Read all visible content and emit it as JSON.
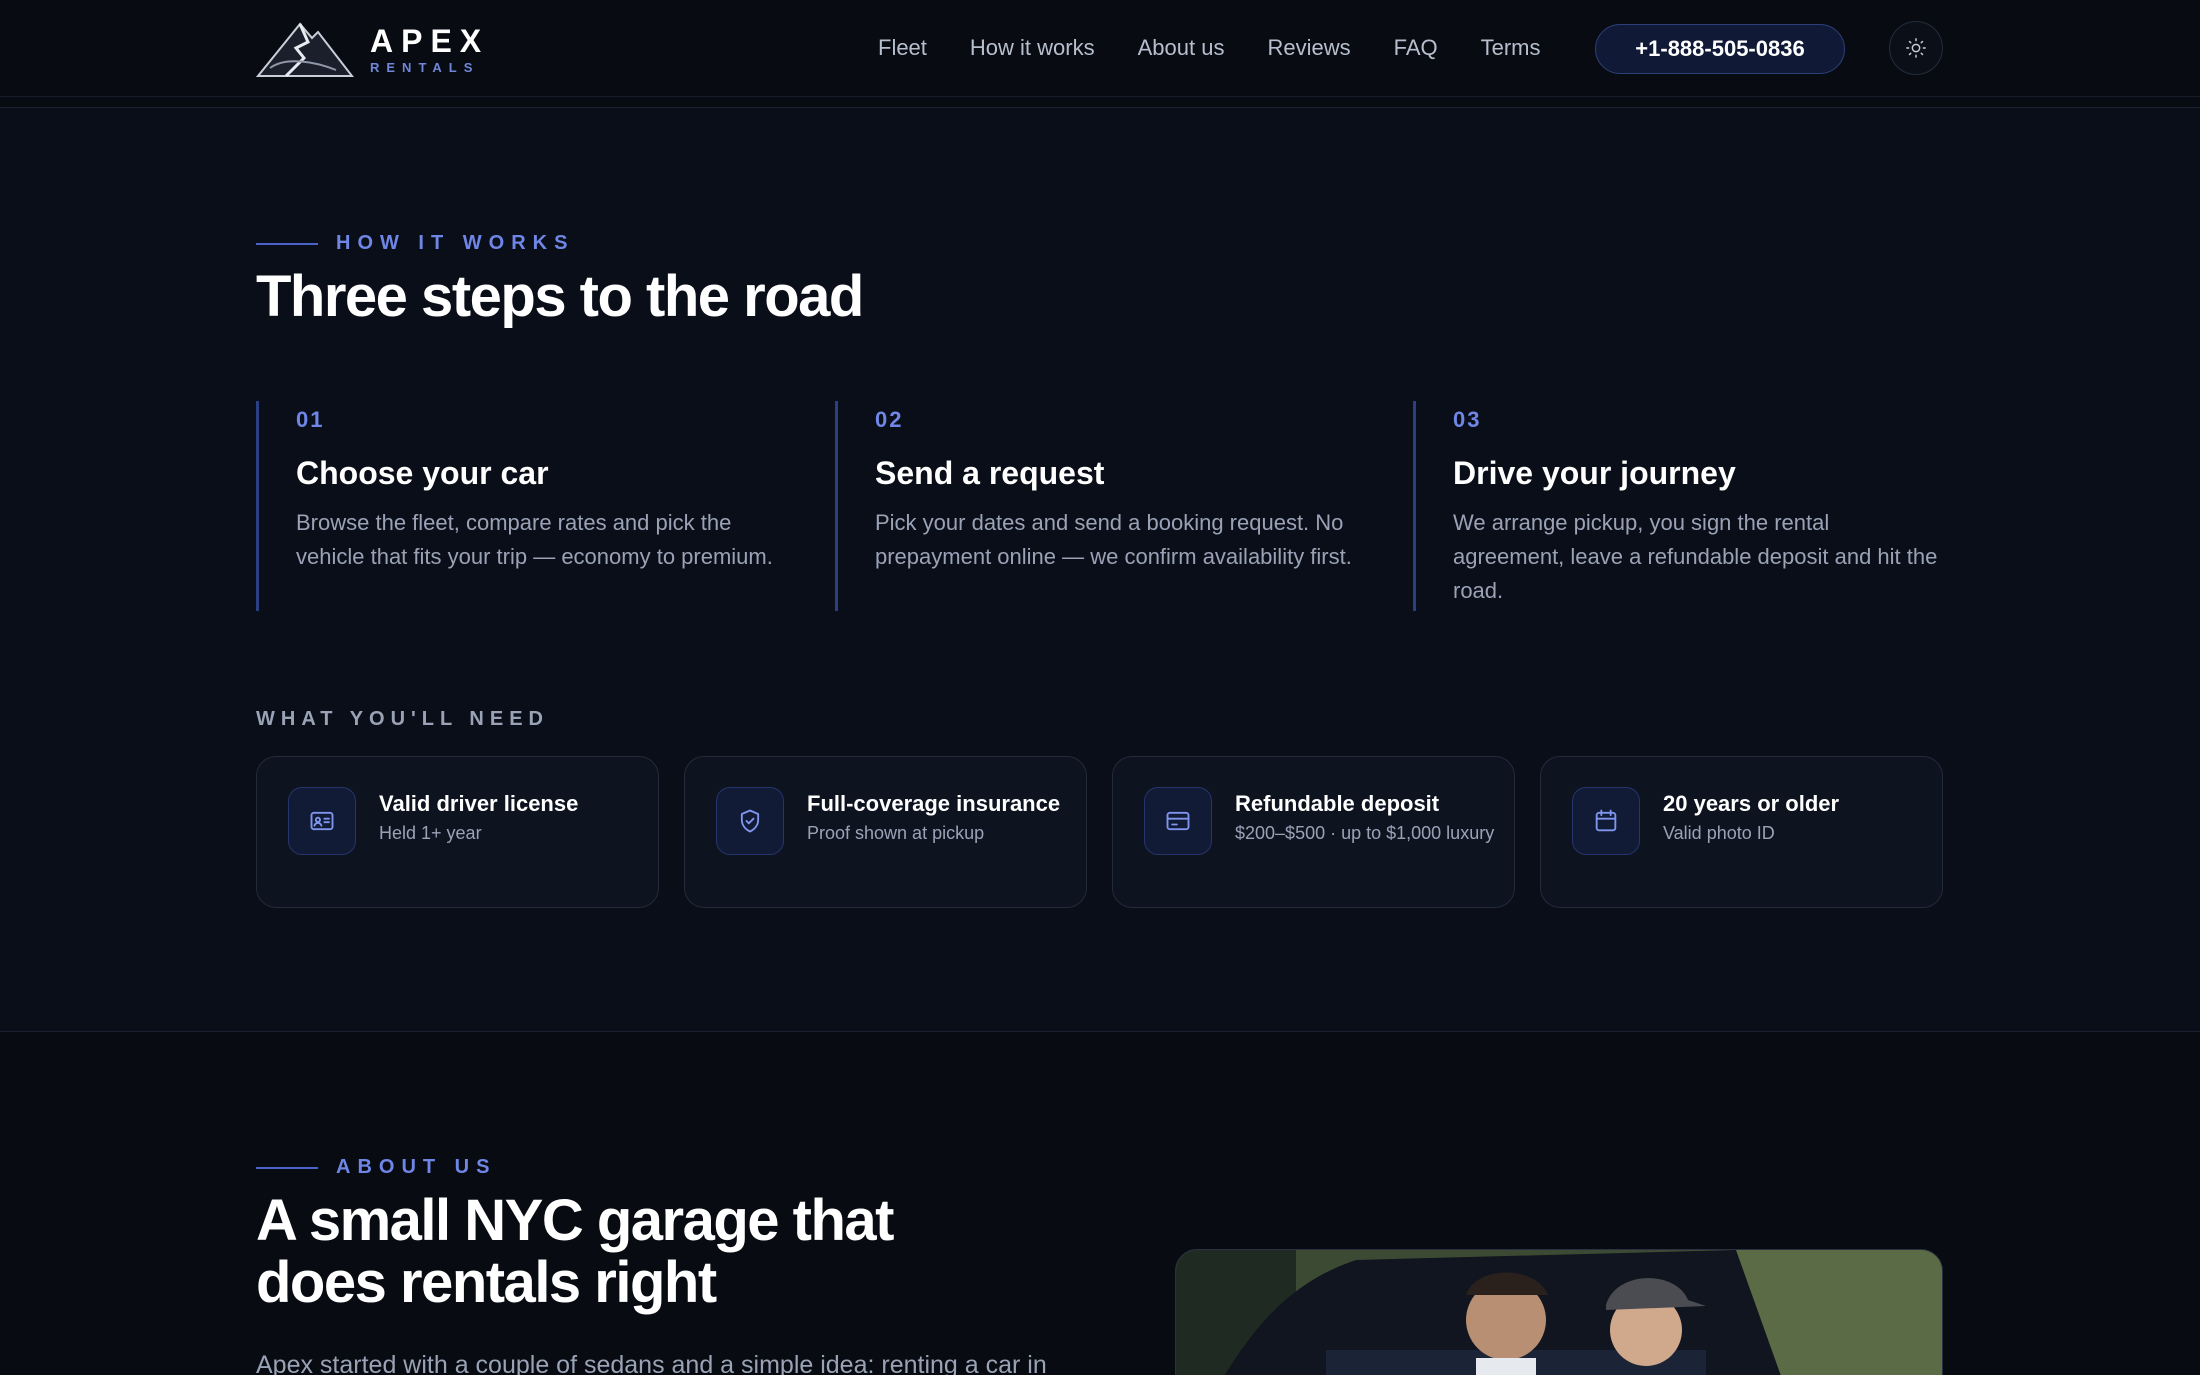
{
  "brand": {
    "name": "APEX",
    "tagline": "RENTALS"
  },
  "nav": {
    "items": [
      "Fleet",
      "How it works",
      "About us",
      "Reviews",
      "FAQ",
      "Terms"
    ],
    "phone": "+1-888-505-0836",
    "theme_icon": "sun-icon"
  },
  "how": {
    "eyebrow": "HOW IT WORKS",
    "title": "Three steps to the road",
    "steps": [
      {
        "num": "01",
        "title": "Choose your car",
        "desc": "Browse the fleet, compare rates and pick the vehicle that fits your trip — economy to premium."
      },
      {
        "num": "02",
        "title": "Send a request",
        "desc": "Pick your dates and send a booking request. No prepayment online — we confirm availability first."
      },
      {
        "num": "03",
        "title": "Drive your journey",
        "desc": "We arrange pickup, you sign the rental agreement, leave a refundable deposit and hit the road."
      }
    ],
    "need_label": "WHAT YOU'LL NEED",
    "requirements": [
      {
        "icon": "id-card-icon",
        "title": "Valid driver license",
        "sub": "Held 1+ year"
      },
      {
        "icon": "shield-check-icon",
        "title": "Full-coverage insurance",
        "sub": "Proof shown at pickup"
      },
      {
        "icon": "credit-card-icon",
        "title": "Refundable deposit",
        "sub": "$200–$500 · up to $1,000 luxury"
      },
      {
        "icon": "calendar-icon",
        "title": "20 years or older",
        "sub": "Valid photo ID"
      }
    ]
  },
  "about": {
    "eyebrow": "ABOUT US",
    "title_line1": "A small NYC garage that",
    "title_line2": "does rentals right",
    "intro": "Apex started with a couple of sedans and a simple idea: renting a car in"
  },
  "colors": {
    "accent": "#6f86e6",
    "background": "#0a0e18",
    "card": "#0e1320"
  }
}
